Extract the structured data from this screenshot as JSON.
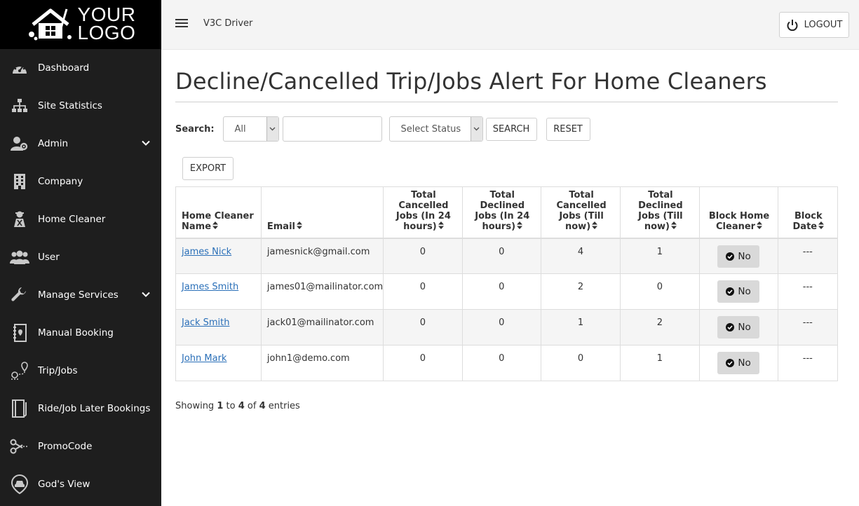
{
  "logo": {
    "line1": "YOUR",
    "line2": "LOGO"
  },
  "sidebar": {
    "items": [
      {
        "label": "Dashboard",
        "icon": "dashboard-icon",
        "has_submenu": false
      },
      {
        "label": "Site Statistics",
        "icon": "sitemap-icon",
        "has_submenu": false
      },
      {
        "label": "Admin",
        "icon": "admin-users-icon",
        "has_submenu": true
      },
      {
        "label": "Company",
        "icon": "building-icon",
        "has_submenu": false
      },
      {
        "label": "Home Cleaner",
        "icon": "cleaner-icon",
        "has_submenu": false
      },
      {
        "label": "User",
        "icon": "users-icon",
        "has_submenu": false
      },
      {
        "label": "Manage Services",
        "icon": "wrench-icon",
        "has_submenu": true
      },
      {
        "label": "Manual Booking",
        "icon": "booking-book-icon",
        "has_submenu": false
      },
      {
        "label": "Trip/Jobs",
        "icon": "route-pin-icon",
        "has_submenu": false
      },
      {
        "label": "Ride/Job Later Bookings",
        "icon": "notebook-icon",
        "has_submenu": false
      },
      {
        "label": "PromoCode",
        "icon": "scissors-icon",
        "has_submenu": false
      },
      {
        "label": "God's View",
        "icon": "car-pin-icon",
        "has_submenu": false
      }
    ]
  },
  "header": {
    "brand": "V3C Driver",
    "logout_label": "LOGOUT"
  },
  "page": {
    "title": "Decline/Cancelled Trip/Jobs Alert For Home Cleaners",
    "search_label": "Search:",
    "filter_value": "All",
    "search_value": "",
    "status_value": "Select Status",
    "search_button": "SEARCH",
    "reset_button": "RESET",
    "export_button": "EXPORT"
  },
  "table": {
    "headers": [
      "Home Cleaner Name",
      "Email",
      "Total Cancelled Jobs (In 24 hours)",
      "Total Declined Jobs (In 24 hours)",
      "Total Cancelled Jobs (Till now)",
      "Total Declined Jobs (Till now)",
      "Block Home Cleaner",
      "Block Date"
    ],
    "rows": [
      {
        "name": "james Nick",
        "email": "jamesnick@gmail.com",
        "c24": "0",
        "d24": "0",
        "ctotal": "4",
        "dtotal": "1",
        "block": "No",
        "block_date": "---"
      },
      {
        "name": "James Smith",
        "email": "james01@mailinator.com",
        "c24": "0",
        "d24": "0",
        "ctotal": "2",
        "dtotal": "0",
        "block": "No",
        "block_date": "---"
      },
      {
        "name": "Jack Smith",
        "email": "jack01@mailinator.com",
        "c24": "0",
        "d24": "0",
        "ctotal": "1",
        "dtotal": "2",
        "block": "No",
        "block_date": "---"
      },
      {
        "name": "John Mark",
        "email": "john1@demo.com",
        "c24": "0",
        "d24": "0",
        "ctotal": "0",
        "dtotal": "1",
        "block": "No",
        "block_date": "---"
      }
    ]
  },
  "footer": {
    "prefix": "Showing",
    "from": "1",
    "to_word": "to",
    "to": "4",
    "of_word": "of",
    "total": "4",
    "suffix": "entries"
  },
  "colors": {
    "sidebar_bg": "#1e1e1e",
    "link": "#2a6fb8",
    "header_bg": "#f4f4f4"
  }
}
